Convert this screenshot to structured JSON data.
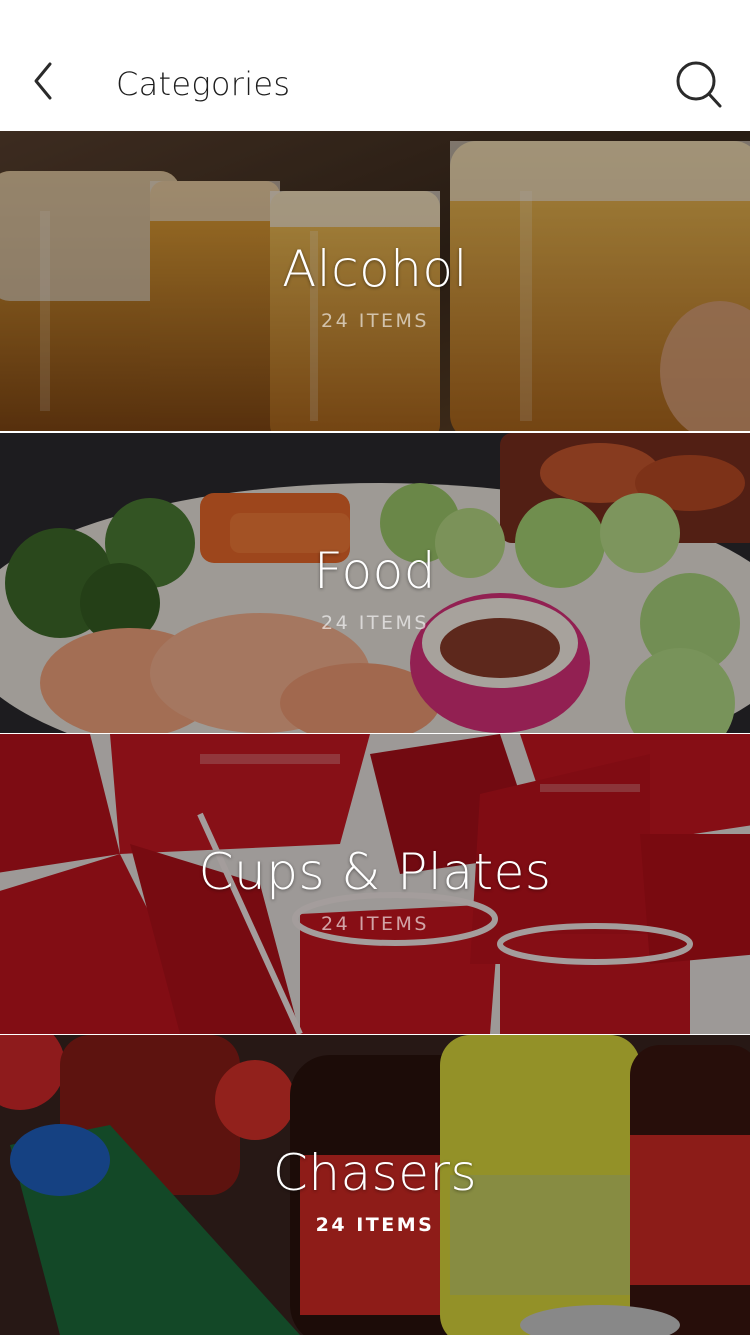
{
  "header": {
    "title": "Categories",
    "back_icon": "chevron-left-icon",
    "search_icon": "search-icon"
  },
  "categories": [
    {
      "title": "Alcohol",
      "count": "24 ITEMS",
      "theme": "beer-glasses",
      "accent": "#c98a2b"
    },
    {
      "title": "Food",
      "count": "24 ITEMS",
      "theme": "shrimp-and-vegetable-platter",
      "accent": "#7fb04a"
    },
    {
      "title": "Cups & Plates",
      "count": "24 ITEMS",
      "theme": "red-party-cups",
      "accent": "#b31a22"
    },
    {
      "title": "Chasers",
      "count": "24 ITEMS",
      "theme": "soda-bottles",
      "accent": "#c4281f"
    }
  ]
}
